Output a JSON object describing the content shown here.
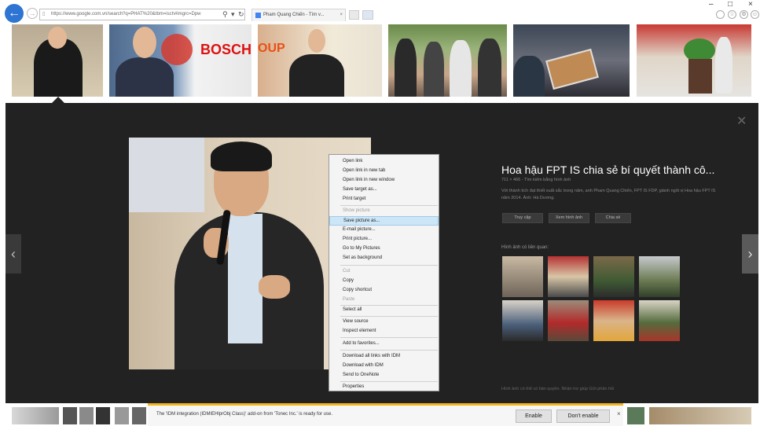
{
  "browser": {
    "url": "https://www.google.com.vn/search?q=PHAT%20&tbm=isch#imgrc=Dpw",
    "tab_title": "Pham Quang Chiến - Tìm v...",
    "back_icon": "arrow-left-icon",
    "forward_icon": "arrow-right-icon",
    "accent": "#2d74d3"
  },
  "viewer": {
    "title": "Hoa hậu FPT IS chia sẻ bí quyết thành cô...",
    "meta": "711 × 466 - Tìm kiếm bằng hình ảnh",
    "description": "Với thành tích đạt thiết xuất sắc trong năm, anh Pham Quang Chiến, FPT IS FDP, giành ngôi vị Hoa hậu FPT IS năm 2014. Ảnh: Hà Dương.",
    "buttons": [
      "Truy cập",
      "Xem hình ảnh",
      "Chia sẻ"
    ],
    "related_label": "Hình ảnh có liên quan:",
    "footer": "Hình ảnh có thể có bản quyền.   Nhận trợ giúp   Gửi phản hồi"
  },
  "context_menu": {
    "items": [
      {
        "label": "Open link",
        "disabled": false
      },
      {
        "label": "Open link in new tab",
        "disabled": false
      },
      {
        "label": "Open link in new window",
        "disabled": false
      },
      {
        "label": "Save target as...",
        "disabled": false
      },
      {
        "label": "Print target",
        "disabled": false
      },
      {
        "label": "Show picture",
        "disabled": true
      },
      {
        "label": "Save picture as...",
        "disabled": false,
        "highlighted": true
      },
      {
        "label": "E-mail picture...",
        "disabled": false
      },
      {
        "label": "Print picture...",
        "disabled": false
      },
      {
        "label": "Go to My Pictures",
        "disabled": false
      },
      {
        "label": "Set as background",
        "disabled": false
      },
      {
        "label": "Cut",
        "disabled": true
      },
      {
        "label": "Copy",
        "disabled": false
      },
      {
        "label": "Copy shortcut",
        "disabled": false
      },
      {
        "label": "Paste",
        "disabled": true
      },
      {
        "label": "Select all",
        "disabled": false
      },
      {
        "label": "View source",
        "disabled": false
      },
      {
        "label": "Inspect element",
        "disabled": false
      },
      {
        "label": "Add to favorites...",
        "disabled": false
      },
      {
        "label": "Download all links with IDM",
        "disabled": false
      },
      {
        "label": "Download with IDM",
        "disabled": false
      },
      {
        "label": "Send to OneNote",
        "disabled": false
      },
      {
        "label": "Properties",
        "disabled": false
      }
    ]
  },
  "notification": {
    "text": "The 'IDM integration (IDMIEHlprObj Class)' add-on from 'Tonec Inc.' is ready for use.",
    "enable": "Enable",
    "dont_enable": "Don't enable",
    "close": "×",
    "accent": "#f3b51b"
  }
}
